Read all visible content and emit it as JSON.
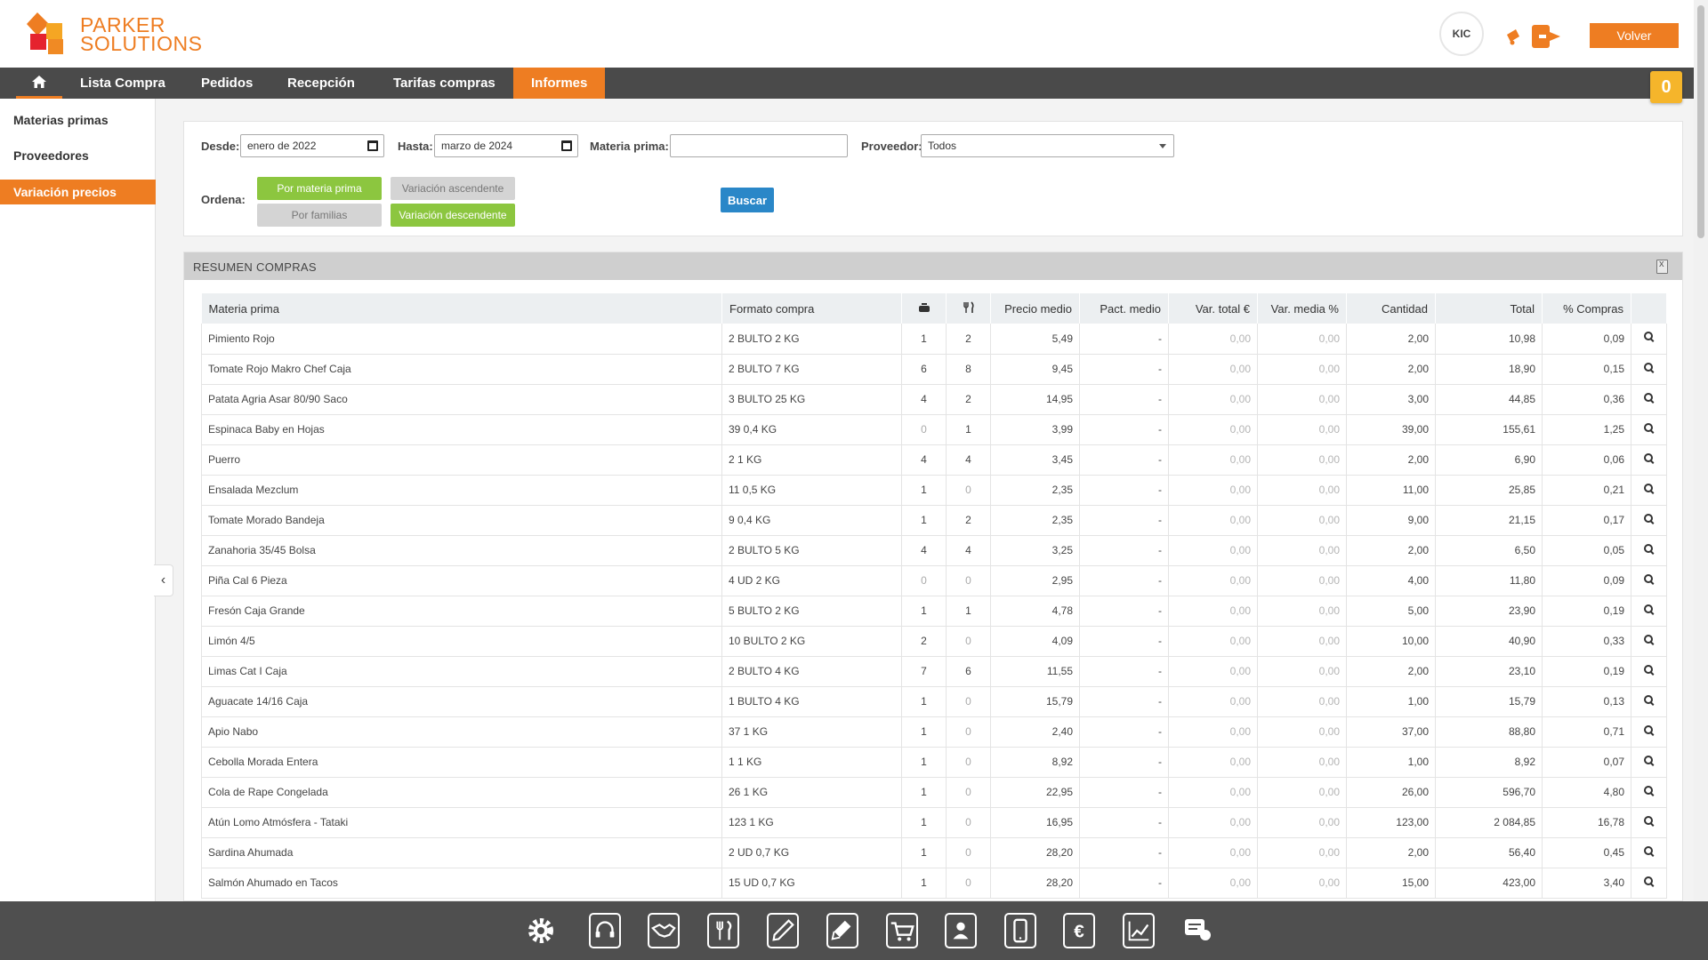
{
  "brand": {
    "line1": "PARKER",
    "line2": "SOLUTIONS",
    "accent": "#ee7d22"
  },
  "header": {
    "avatar_text": "KIC",
    "volver_label": "Volver",
    "bell_icon": "bell-icon",
    "logout_icon": "logout-icon"
  },
  "nav": {
    "home_icon": "home-icon",
    "items": [
      "Lista Compra",
      "Pedidos",
      "Recepción",
      "Tarifas compras",
      "Informes"
    ],
    "active": "Informes",
    "cart_count": "0"
  },
  "sidebar": {
    "items": [
      "Materias primas",
      "Proveedores",
      "Variación precios"
    ],
    "active": "Variación precios"
  },
  "filters": {
    "desde_label": "Desde:",
    "desde_value": "enero de 2022",
    "hasta_label": "Hasta:",
    "hasta_value": "marzo de 2024",
    "materia_label": "Materia prima:",
    "materia_value": "",
    "proveedor_label": "Proveedor:",
    "proveedor_value": "Todos",
    "ordena_label": "Ordena:",
    "order_buttons": [
      "Por materia prima",
      "Variación ascendente",
      "Por familias",
      "Variación descendente"
    ],
    "buscar_label": "Buscar"
  },
  "resumen": {
    "title": "RESUMEN COMPRAS",
    "columns": [
      "Materia prima",
      "Formato compra",
      "pot-icon",
      "cutlery-icon",
      "Precio medio",
      "Pact. medio",
      "Var. total €",
      "Var. media %",
      "Cantidad",
      "Total",
      "% Compras",
      ""
    ],
    "rows": [
      [
        "Pimiento Rojo",
        "2 BULTO 2 KG",
        "1",
        "2",
        "5,49",
        "-",
        "0,00",
        "0,00",
        "2,00",
        "10,98",
        "0,09"
      ],
      [
        "Tomate Rojo Makro Chef Caja",
        "2 BULTO 7 KG",
        "6",
        "8",
        "9,45",
        "-",
        "0,00",
        "0,00",
        "2,00",
        "18,90",
        "0,15"
      ],
      [
        "Patata Agria Asar 80/90 Saco",
        "3 BULTO 25 KG",
        "4",
        "2",
        "14,95",
        "-",
        "0,00",
        "0,00",
        "3,00",
        "44,85",
        "0,36"
      ],
      [
        "Espinaca Baby en Hojas",
        "39 0,4 KG",
        "0",
        "1",
        "3,99",
        "-",
        "0,00",
        "0,00",
        "39,00",
        "155,61",
        "1,25"
      ],
      [
        "Puerro",
        "2 1 KG",
        "4",
        "4",
        "3,45",
        "-",
        "0,00",
        "0,00",
        "2,00",
        "6,90",
        "0,06"
      ],
      [
        "Ensalada Mezclum",
        "11 0,5 KG",
        "1",
        "0",
        "2,35",
        "-",
        "0,00",
        "0,00",
        "11,00",
        "25,85",
        "0,21"
      ],
      [
        "Tomate Morado Bandeja",
        "9 0,4 KG",
        "1",
        "2",
        "2,35",
        "-",
        "0,00",
        "0,00",
        "9,00",
        "21,15",
        "0,17"
      ],
      [
        "Zanahoria 35/45 Bolsa",
        "2 BULTO 5 KG",
        "4",
        "4",
        "3,25",
        "-",
        "0,00",
        "0,00",
        "2,00",
        "6,50",
        "0,05"
      ],
      [
        "Piña Cal 6 Pieza",
        "4 UD 2 KG",
        "0",
        "0",
        "2,95",
        "-",
        "0,00",
        "0,00",
        "4,00",
        "11,80",
        "0,09"
      ],
      [
        "Fresón Caja Grande",
        "5 BULTO 2 KG",
        "1",
        "1",
        "4,78",
        "-",
        "0,00",
        "0,00",
        "5,00",
        "23,90",
        "0,19"
      ],
      [
        "Limón 4/5",
        "10 BULTO 2 KG",
        "2",
        "0",
        "4,09",
        "-",
        "0,00",
        "0,00",
        "10,00",
        "40,90",
        "0,33"
      ],
      [
        "Limas Cat I Caja",
        "2 BULTO 4 KG",
        "7",
        "6",
        "11,55",
        "-",
        "0,00",
        "0,00",
        "2,00",
        "23,10",
        "0,19"
      ],
      [
        "Aguacate 14/16 Caja",
        "1 BULTO 4 KG",
        "1",
        "0",
        "15,79",
        "-",
        "0,00",
        "0,00",
        "1,00",
        "15,79",
        "0,13"
      ],
      [
        "Apio Nabo",
        "37 1 KG",
        "1",
        "0",
        "2,40",
        "-",
        "0,00",
        "0,00",
        "37,00",
        "88,80",
        "0,71"
      ],
      [
        "Cebolla Morada Entera",
        "1 1 KG",
        "1",
        "0",
        "8,92",
        "-",
        "0,00",
        "0,00",
        "1,00",
        "8,92",
        "0,07"
      ],
      [
        "Cola de Rape Congelada",
        "26 1 KG",
        "1",
        "0",
        "22,95",
        "-",
        "0,00",
        "0,00",
        "26,00",
        "596,70",
        "4,80"
      ],
      [
        "Atún Lomo Atmósfera - Tataki",
        "123 1 KG",
        "1",
        "0",
        "16,95",
        "-",
        "0,00",
        "0,00",
        "123,00",
        "2 084,85",
        "16,78"
      ],
      [
        "Sardina Ahumada",
        "2 UD 0,7 KG",
        "1",
        "0",
        "28,20",
        "-",
        "0,00",
        "0,00",
        "2,00",
        "56,40",
        "0,45"
      ],
      [
        "Salmón Ahumado en Tacos",
        "15 UD 0,7 KG",
        "1",
        "0",
        "28,20",
        "-",
        "0,00",
        "0,00",
        "15,00",
        "423,00",
        "3,40"
      ]
    ]
  },
  "dock": [
    "gear-icon",
    "headset-icon",
    "handshake-icon",
    "menu-cutlery-icon",
    "pen-icon",
    "pencil-icon",
    "cart-icon",
    "contacts-icon",
    "tablet-icon",
    "euro-book-icon",
    "chart-icon",
    "messages-icon"
  ]
}
